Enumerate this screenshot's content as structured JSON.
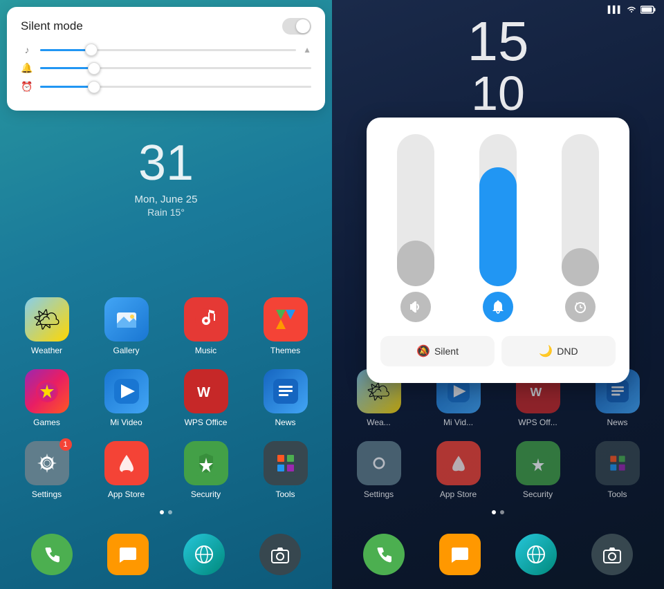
{
  "left": {
    "silent_card": {
      "title": "Silent mode",
      "toggle_state": "off"
    },
    "date": "31",
    "date_label": "Mon, June 25",
    "weather": "Rain 15°",
    "apps_row1": [
      {
        "name": "Weather",
        "icon_class": "icon-weather",
        "emoji": "🌤"
      },
      {
        "name": "Gallery",
        "icon_class": "icon-gallery",
        "emoji": "🖼"
      },
      {
        "name": "Music",
        "icon_class": "icon-music",
        "emoji": "🎵"
      },
      {
        "name": "Themes",
        "icon_class": "icon-themes",
        "emoji": "🎨"
      }
    ],
    "apps_row2": [
      {
        "name": "Games",
        "icon_class": "icon-games",
        "emoji": "⭐"
      },
      {
        "name": "Mi Video",
        "icon_class": "icon-mivideo",
        "emoji": "▶"
      },
      {
        "name": "WPS Office",
        "icon_class": "icon-wps",
        "emoji": "W"
      },
      {
        "name": "News",
        "icon_class": "icon-news",
        "emoji": "≡"
      }
    ],
    "apps_row3": [
      {
        "name": "Settings",
        "icon_class": "icon-settings",
        "emoji": "⚙",
        "badge": "1"
      },
      {
        "name": "App Store",
        "icon_class": "icon-appstore",
        "emoji": "🛍"
      },
      {
        "name": "Security",
        "icon_class": "icon-security",
        "emoji": "⚡"
      },
      {
        "name": "Tools",
        "icon_class": "icon-tools",
        "emoji": "⊞"
      }
    ],
    "dock": [
      {
        "name": "Phone",
        "class": "dock-phone",
        "emoji": "📞"
      },
      {
        "name": "Messages",
        "class": "dock-msg",
        "emoji": "💬"
      },
      {
        "name": "Browser",
        "class": "dock-browser",
        "emoji": "🌐"
      },
      {
        "name": "Camera",
        "class": "dock-camera",
        "emoji": "📷"
      }
    ]
  },
  "right": {
    "clock_hour": "15",
    "clock_min": "10",
    "status": {
      "signal": "▌▌▌",
      "wifi": "WiFi",
      "battery": "🔋"
    },
    "volume_card": {
      "sliders": [
        {
          "label": "music",
          "icon": "♪",
          "fill_pct": 30,
          "color": "gray"
        },
        {
          "label": "ring",
          "icon": "🔔",
          "fill_pct": 75,
          "color": "blue"
        },
        {
          "label": "alarm",
          "icon": "⏰",
          "fill_pct": 25,
          "color": "gray"
        }
      ],
      "buttons": [
        {
          "label": "Silent",
          "icon": "🔕"
        },
        {
          "label": "DND",
          "icon": "🌙"
        }
      ]
    },
    "apps_row1": [
      {
        "name": "Weather",
        "icon_class": "icon-weather",
        "emoji": "🌤"
      },
      {
        "name": "Mi Video",
        "icon_class": "icon-mivideo",
        "emoji": "▶"
      },
      {
        "name": "WPS Office",
        "icon_class": "icon-wps",
        "emoji": "W"
      },
      {
        "name": "News",
        "icon_class": "icon-news",
        "emoji": "≡"
      }
    ],
    "apps_row2": [
      {
        "name": "Settings",
        "icon_class": "icon-settings",
        "emoji": "⚙"
      },
      {
        "name": "App Store",
        "icon_class": "icon-appstore",
        "emoji": "🛍"
      },
      {
        "name": "Security",
        "icon_class": "icon-security",
        "emoji": "⚡"
      },
      {
        "name": "Tools",
        "icon_class": "icon-tools",
        "emoji": "⊞"
      }
    ]
  },
  "sliders": {
    "music_pct": "20",
    "ring_pct": "20",
    "alarm_pct": "20"
  }
}
